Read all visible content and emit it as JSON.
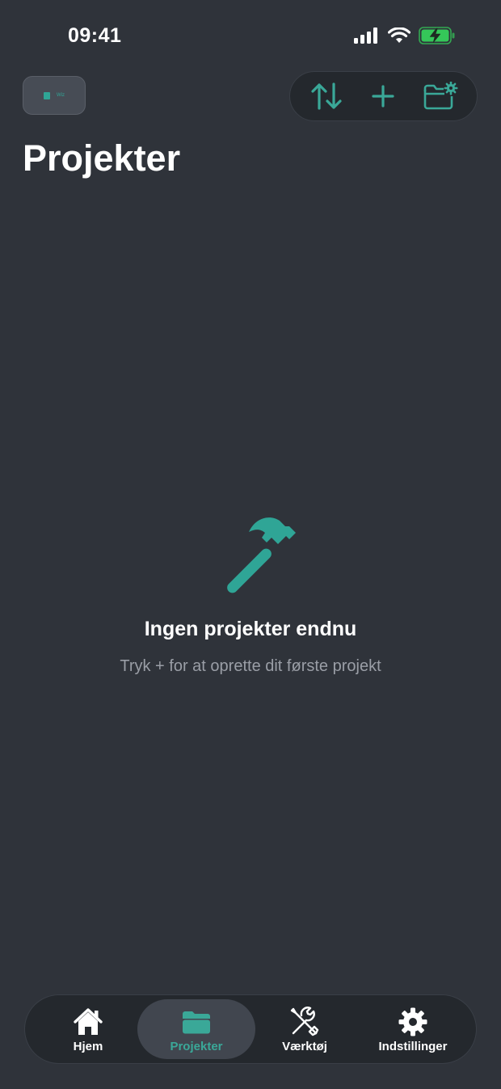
{
  "status_bar": {
    "time": "09:41"
  },
  "header": {
    "logo_text": "Wiz",
    "title": "Projekter",
    "toolbar": {
      "sort_icon": "arrow-up-down-icon",
      "add_icon": "plus-icon",
      "folder_settings_icon": "folder-gear-icon"
    }
  },
  "empty_state": {
    "icon": "hammer-icon",
    "title": "Ingen projekter endnu",
    "subtitle": "Tryk + for at oprette dit første projekt"
  },
  "tab_bar": {
    "tabs": [
      {
        "label": "Hjem",
        "icon": "house-icon",
        "active": false
      },
      {
        "label": "Projekter",
        "icon": "folder-icon",
        "active": true
      },
      {
        "label": "Værktøj",
        "icon": "tools-icon",
        "active": false
      },
      {
        "label": "Indstillinger",
        "icon": "gear-icon",
        "active": false
      }
    ]
  },
  "colors": {
    "background": "#2f333a",
    "accent": "#3aa898",
    "toolbar_bg": "#24282d",
    "active_tab_bg": "#41464f",
    "subtitle_gray": "#9a9ea6",
    "battery_green": "#35c759"
  }
}
